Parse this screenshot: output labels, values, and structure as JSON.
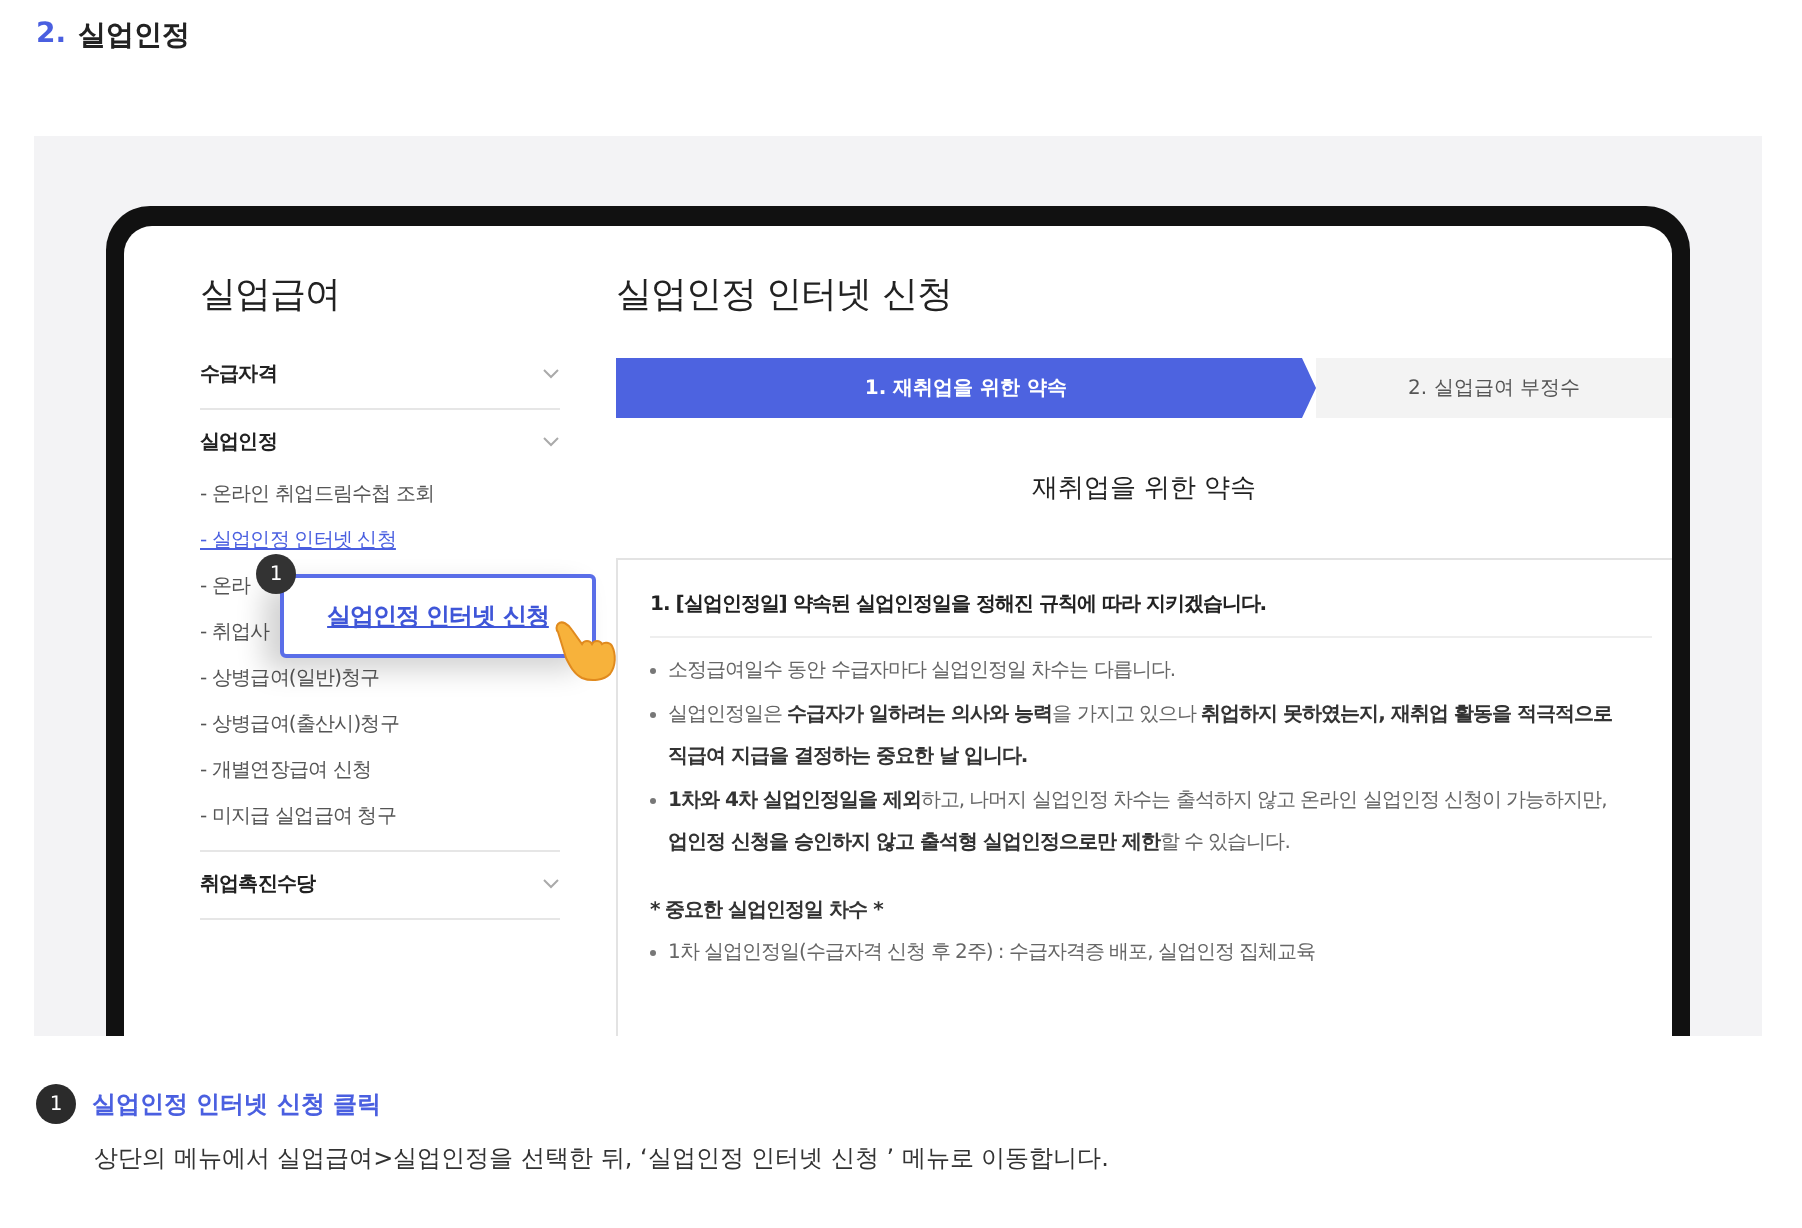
{
  "heading": {
    "number": "2.",
    "title": "실업인정"
  },
  "sidebar": {
    "title": "실업급여",
    "sections": [
      {
        "label": "수급자격"
      },
      {
        "label": "실업인정",
        "items": [
          {
            "label": "- 온라인 취업드림수첩 조회",
            "selected": false
          },
          {
            "label": "- 실업인정 인터넷 신청",
            "selected": true
          },
          {
            "label": "- 온라",
            "selected": false
          },
          {
            "label": "- 취업사",
            "selected": false
          },
          {
            "label": "- 상병급여(일반)청구",
            "selected": false
          },
          {
            "label": "- 상병급여(출산시)청구",
            "selected": false
          },
          {
            "label": "- 개별연장급여 신청",
            "selected": false
          },
          {
            "label": "- 미지급 실업급여 청구",
            "selected": false
          }
        ]
      },
      {
        "label": "취업촉진수당"
      }
    ]
  },
  "callout": {
    "badge": "1",
    "label": "실업인정 인터넷 신청"
  },
  "main": {
    "title": "실업인정 인터넷 신청",
    "steps": [
      {
        "label": "1. 재취업을 위한 약속",
        "selected": true
      },
      {
        "label": "2. 실업급여 부정수",
        "selected": false
      }
    ],
    "section_title": "재취업을 위한 약속",
    "item_title": "1. [실업인정일] 약속된 실업인정일을 정해진 규칙에 따라 지키겠습니다.",
    "bullets": [
      {
        "lines": [
          "소정급여일수 동안 수급자마다 실업인정일 차수는 다릅니다."
        ]
      },
      {
        "lines": [
          "실업인정일은 **수급자가 일하려는 의사와 능력**을 가지고 있으나 **취업하지 못하였는지, 재취업 활동을 적극적으로**",
          "**직급여 지급을 결정하는 중요한 날 입니다.**"
        ]
      },
      {
        "lines": [
          "**1차와 4차 실업인정일을 제외**하고, 나머지 실업인정 차수는 출석하지 않고 온라인 실업인정 신청이 가능하지만,",
          "**업인정 신청을 승인하지 않고 출석형 실업인정으로만 제한**할 수 있습니다."
        ]
      }
    ],
    "subheading": "* 중요한 실업인정일 차수 *",
    "sub_bullets": [
      {
        "lines": [
          "1차 실업인정일(수급자격 신청 후 2주) : 수급자격증 배포, 실업인정 집체교육"
        ]
      }
    ]
  },
  "footer": {
    "badge": "1",
    "title": "실업인정 인터넷 신청 클릭",
    "description": "상단의 메뉴에서 실업급여>실업인정을 선택한 뒤, ‘실업인정 인터넷 신청 ’  메뉴로 이동합니다."
  }
}
